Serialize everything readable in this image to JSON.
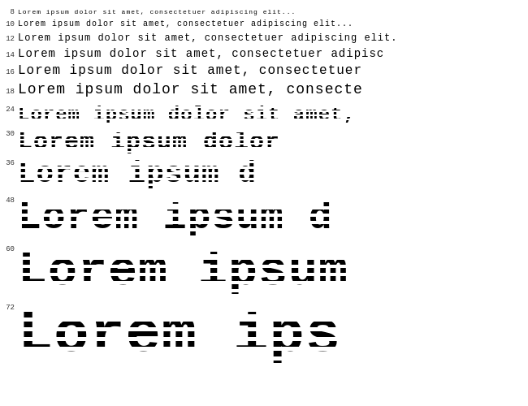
{
  "lines": [
    {
      "size": 8,
      "number": "8",
      "text": "Lorem ipsum dolor sit amet, consectetuer adipiscing elit..."
    },
    {
      "size": 10,
      "number": "10",
      "text": "Lorem ipsum dolor sit amet, consectetuer adipiscing elit..."
    },
    {
      "size": 12,
      "number": "12",
      "text": "Lorem ipsum dolor sit amet, consectetuer adipiscing elit."
    },
    {
      "size": 14,
      "number": "14",
      "text": "Lorem ipsum dolor sit amet, consectetuer adipisc"
    },
    {
      "size": 16,
      "number": "16",
      "text": "Lorem ipsum dolor sit amet, consectetuer"
    },
    {
      "size": 18,
      "number": "18",
      "text": "Lorem ipsum dolor sit amet, consecte"
    },
    {
      "size": 24,
      "number": "24",
      "text": "Lorem ipsum dolor sit amet,"
    },
    {
      "size": 30,
      "number": "30",
      "text": "Lorem ipsum dolor"
    },
    {
      "size": 36,
      "number": "36",
      "text": "Lorem ipsum d"
    },
    {
      "size": 48,
      "number": "48",
      "text": "Lorem ipsum d"
    },
    {
      "size": 60,
      "number": "60",
      "text": "Lorem ipsum"
    },
    {
      "size": 72,
      "number": "72",
      "text": "Lorem ips"
    }
  ]
}
